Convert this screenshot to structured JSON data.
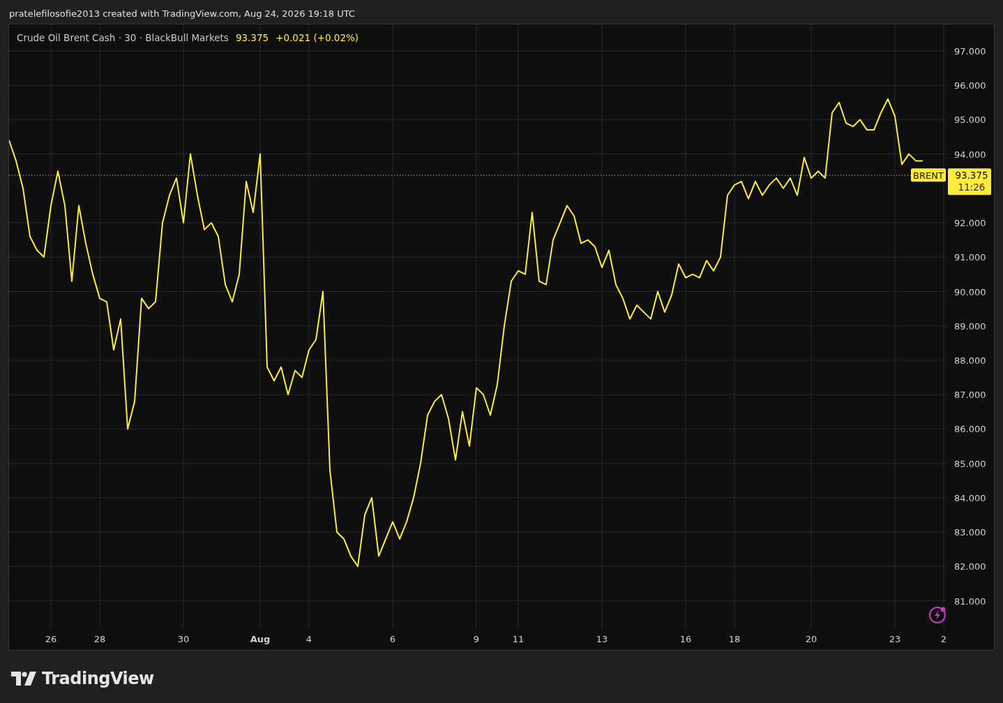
{
  "header": {
    "text": "pratelefilosofie2013 created with TradingView.com, Aug 24, 2026 19:18 UTC"
  },
  "legend": {
    "symbol": "Crude Oil Brent Cash · 30 · BlackBull Markets",
    "price": "93.375",
    "change": "+0.021 (+0.02%)"
  },
  "price_label": {
    "price": "93.375",
    "countdown": "11:26"
  },
  "chart_data": {
    "type": "line",
    "grid": true,
    "ylim": [
      80.2,
      97.77
    ],
    "ref_lines": [
      {
        "axis": "y",
        "value": 93.38,
        "color": "#ffeb3b"
      }
    ],
    "categories": [
      null,
      null,
      null,
      null,
      null,
      null,
      "26",
      null,
      null,
      null,
      null,
      null,
      null,
      "28",
      null,
      null,
      null,
      null,
      null,
      null,
      null,
      null,
      null,
      null,
      null,
      "30",
      null,
      null,
      null,
      null,
      null,
      null,
      null,
      null,
      null,
      null,
      "Aug",
      null,
      null,
      null,
      null,
      null,
      null,
      "4",
      null,
      null,
      null,
      null,
      null,
      null,
      null,
      null,
      null,
      null,
      null,
      "6",
      null,
      null,
      null,
      null,
      null,
      null,
      null,
      null,
      null,
      null,
      null,
      "9",
      null,
      null,
      null,
      null,
      null,
      "11",
      null,
      null,
      null,
      null,
      null,
      null,
      null,
      null,
      null,
      null,
      null,
      "13",
      null,
      null,
      null,
      null,
      null,
      null,
      null,
      null,
      null,
      null,
      null,
      "16",
      null,
      null,
      null,
      null,
      null,
      null,
      "18",
      null,
      null,
      null,
      null,
      null,
      null,
      null,
      null,
      null,
      null,
      "20",
      null,
      null,
      null,
      null,
      null,
      null,
      null,
      null,
      null,
      null,
      null,
      "23",
      null,
      null,
      null,
      null,
      null,
      null,
      "2"
    ],
    "yticks": [
      {
        "value": 81,
        "label": "81.000"
      },
      {
        "value": 82,
        "label": "82.000"
      },
      {
        "value": 83,
        "label": "83.000"
      },
      {
        "value": 84,
        "label": "84.000"
      },
      {
        "value": 85,
        "label": "85.000"
      },
      {
        "value": 86,
        "label": "86.000"
      },
      {
        "value": 87,
        "label": "87.000"
      },
      {
        "value": 88,
        "label": "88.000"
      },
      {
        "value": 89,
        "label": "89.000"
      },
      {
        "value": 90,
        "label": "90.000"
      },
      {
        "value": 91,
        "label": "91.000"
      },
      {
        "value": 92,
        "label": "92.000"
      },
      {
        "value": 94,
        "label": "94.000"
      },
      {
        "value": 95,
        "label": "95.000"
      },
      {
        "value": 96,
        "label": "96.000"
      },
      {
        "value": 97,
        "label": "97.000"
      }
    ],
    "series": [
      {
        "name": "BRENT",
        "color": "#ffeb3b",
        "values": [
          94.4,
          93.8,
          93.0,
          91.6,
          91.2,
          91.0,
          92.5,
          93.5,
          92.5,
          90.3,
          92.5,
          91.4,
          90.5,
          89.8,
          89.7,
          88.3,
          89.2,
          86.0,
          86.8,
          89.8,
          89.5,
          89.7,
          92.0,
          92.8,
          93.3,
          92.0,
          94.0,
          92.8,
          91.8,
          92.0,
          91.6,
          90.2,
          89.7,
          90.5,
          93.2,
          92.3,
          94.0,
          87.8,
          87.4,
          87.8,
          87.0,
          87.7,
          87.5,
          88.3,
          88.6,
          90.0,
          84.8,
          83.0,
          82.8,
          82.3,
          82.0,
          83.5,
          84.0,
          82.3,
          82.8,
          83.3,
          82.8,
          83.3,
          84.0,
          85.0,
          86.4,
          86.8,
          87.0,
          86.3,
          85.1,
          86.5,
          85.5,
          87.2,
          87.0,
          86.4,
          87.3,
          89.0,
          90.3,
          90.6,
          90.5,
          92.3,
          90.3,
          90.2,
          91.5,
          92.0,
          92.5,
          92.2,
          91.4,
          91.5,
          91.3,
          90.7,
          91.2,
          90.2,
          89.8,
          89.2,
          89.6,
          89.4,
          89.2,
          90.0,
          89.4,
          89.9,
          90.8,
          90.4,
          90.5,
          90.4,
          90.9,
          90.6,
          91.0,
          92.8,
          93.1,
          93.2,
          92.7,
          93.2,
          92.8,
          93.1,
          93.3,
          93.0,
          93.3,
          92.8,
          93.9,
          93.3,
          93.5,
          93.3,
          95.2,
          95.5,
          94.9,
          94.8,
          95.0,
          94.7,
          94.7,
          95.2,
          95.6,
          95.1,
          93.7,
          94.0,
          93.8,
          93.8,
          null,
          null,
          null
        ]
      }
    ]
  },
  "footer": {
    "logo_text": "TradingView"
  }
}
